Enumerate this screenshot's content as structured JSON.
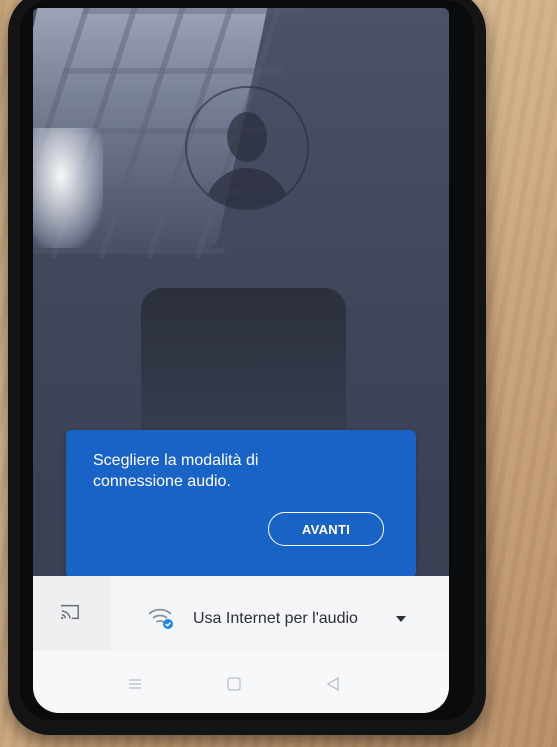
{
  "tooltip": {
    "message": "Scegliere la modalità di connessione audio.",
    "next_label": "AVANTI"
  },
  "audio_bar": {
    "cast_icon": "cast-icon",
    "connection_icon": "wifi-icon",
    "selected_option": "Usa Internet per l'audio",
    "dropdown_icon": "caret-down-icon"
  },
  "nav": {
    "menu_icon": "menu-icon",
    "home_icon": "home-icon",
    "back_icon": "back-icon"
  },
  "colors": {
    "tooltip_blue": "#1a63c6",
    "check_badge_blue": "#1e88e5",
    "bar_background": "#f4f5f7"
  }
}
